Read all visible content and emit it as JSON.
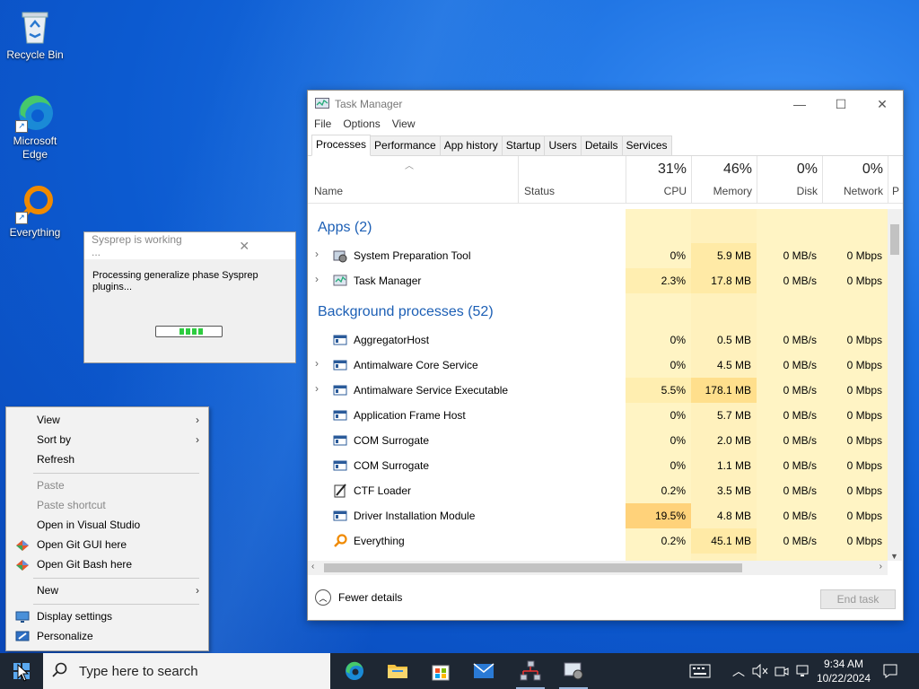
{
  "desktop": {
    "icons": [
      {
        "label": "Recycle Bin",
        "icon": "recycle-bin-icon"
      },
      {
        "label": "Microsoft Edge",
        "icon": "edge-icon"
      },
      {
        "label": "Everything",
        "icon": "everything-icon"
      }
    ]
  },
  "task_manager": {
    "title": "Task Manager",
    "menu": [
      "File",
      "Options",
      "View"
    ],
    "tabs": [
      "Processes",
      "Performance",
      "App history",
      "Startup",
      "Users",
      "Details",
      "Services"
    ],
    "active_tab": "Processes",
    "columns": {
      "name": "Name",
      "status": "Status",
      "cpu": {
        "pct": "31%",
        "label": "CPU"
      },
      "memory": {
        "pct": "46%",
        "label": "Memory"
      },
      "disk": {
        "pct": "0%",
        "label": "Disk"
      },
      "network": {
        "pct": "0%",
        "label": "Network"
      },
      "power_partial": "P"
    },
    "groups": {
      "apps": "Apps (2)",
      "background": "Background processes (52)"
    },
    "apps": [
      {
        "name": "System Preparation Tool",
        "expand": true,
        "cpu": "0%",
        "memory": "5.9 MB",
        "disk": "0 MB/s",
        "network": "0 Mbps"
      },
      {
        "name": "Task Manager",
        "expand": true,
        "cpu": "2.3%",
        "memory": "17.8 MB",
        "disk": "0 MB/s",
        "network": "0 Mbps"
      }
    ],
    "background": [
      {
        "name": "AggregatorHost",
        "expand": false,
        "cpu": "0%",
        "memory": "0.5 MB",
        "disk": "0 MB/s",
        "network": "0 Mbps"
      },
      {
        "name": "Antimalware Core Service",
        "expand": true,
        "cpu": "0%",
        "memory": "4.5 MB",
        "disk": "0 MB/s",
        "network": "0 Mbps"
      },
      {
        "name": "Antimalware Service Executable",
        "expand": true,
        "cpu": "5.5%",
        "memory": "178.1 MB",
        "disk": "0 MB/s",
        "network": "0 Mbps"
      },
      {
        "name": "Application Frame Host",
        "expand": false,
        "cpu": "0%",
        "memory": "5.7 MB",
        "disk": "0 MB/s",
        "network": "0 Mbps"
      },
      {
        "name": "COM Surrogate",
        "expand": false,
        "cpu": "0%",
        "memory": "2.0 MB",
        "disk": "0 MB/s",
        "network": "0 Mbps"
      },
      {
        "name": "COM Surrogate",
        "expand": false,
        "cpu": "0%",
        "memory": "1.1 MB",
        "disk": "0 MB/s",
        "network": "0 Mbps"
      },
      {
        "name": "CTF Loader",
        "expand": false,
        "cpu": "0.2%",
        "memory": "3.5 MB",
        "disk": "0 MB/s",
        "network": "0 Mbps"
      },
      {
        "name": "Driver Installation Module",
        "expand": false,
        "cpu": "19.5%",
        "memory": "4.8 MB",
        "disk": "0 MB/s",
        "network": "0 Mbps"
      },
      {
        "name": "Everything",
        "expand": false,
        "cpu": "0.2%",
        "memory": "45.1 MB",
        "disk": "0 MB/s",
        "network": "0 Mbps"
      }
    ],
    "fewer_details": "Fewer details",
    "end_task": "End task"
  },
  "sysprep_dialog": {
    "title": "Sysprep is working ...",
    "message": "Processing generalize phase Sysprep plugins..."
  },
  "context_menu": {
    "items": [
      {
        "label": "View",
        "submenu": true,
        "disabled": false
      },
      {
        "label": "Sort by",
        "submenu": true,
        "disabled": false
      },
      {
        "label": "Refresh",
        "submenu": false,
        "disabled": false
      },
      {
        "label": "Paste",
        "submenu": false,
        "disabled": true
      },
      {
        "label": "Paste shortcut",
        "submenu": false,
        "disabled": true
      },
      {
        "label": "Open in Visual Studio",
        "submenu": false,
        "disabled": false
      },
      {
        "label": "Open Git GUI here",
        "submenu": false,
        "disabled": false,
        "icon": "git-icon"
      },
      {
        "label": "Open Git Bash here",
        "submenu": false,
        "disabled": false,
        "icon": "git-icon"
      },
      {
        "label": "New",
        "submenu": true,
        "disabled": false
      },
      {
        "label": "Display settings",
        "submenu": false,
        "disabled": false,
        "icon": "display-icon"
      },
      {
        "label": "Personalize",
        "submenu": false,
        "disabled": false,
        "icon": "personalize-icon"
      }
    ]
  },
  "taskbar": {
    "search_placeholder": "Type here to search",
    "time": "9:34 AM",
    "date": "10/22/2024",
    "pinned": [
      "edge-icon",
      "file-explorer-icon",
      "store-icon",
      "mail-icon",
      "network-app-icon",
      "sysprep-app-icon"
    ]
  },
  "colors": {
    "heat_light": "#fff4c4",
    "heat_mid": "#ffe8a0",
    "heat_high": "#ffd27a",
    "group_blue": "#1c5fb5",
    "taskbar": "#1e2733"
  }
}
